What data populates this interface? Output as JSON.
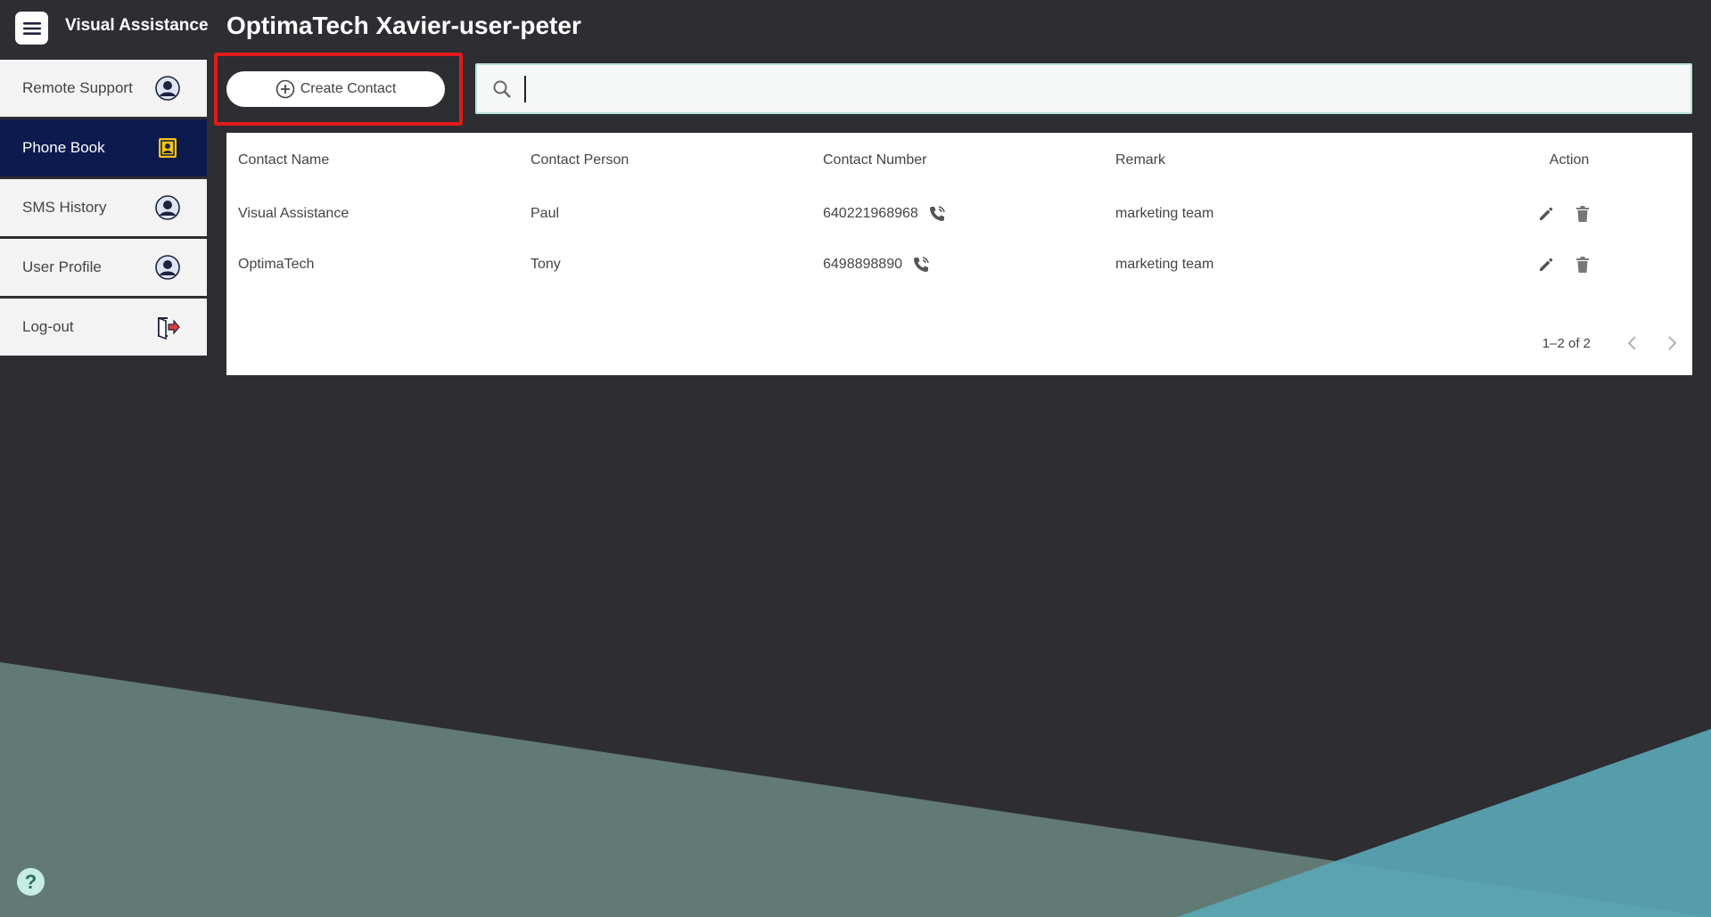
{
  "header": {
    "app_title": "Visual Assistance",
    "page_title": "OptimaTech Xavier-user-peter"
  },
  "sidebar": {
    "items": [
      {
        "label": "Remote Support",
        "icon": "user-avatar-icon",
        "active": false
      },
      {
        "label": "Phone Book",
        "icon": "contact-book-icon",
        "active": true
      },
      {
        "label": "SMS History",
        "icon": "user-avatar-icon",
        "active": false
      },
      {
        "label": "User Profile",
        "icon": "user-avatar-icon",
        "active": false
      },
      {
        "label": "Log-out",
        "icon": "logout-icon",
        "active": false
      }
    ]
  },
  "toolbar": {
    "create_label": "Create Contact",
    "search_value": "",
    "search_placeholder": ""
  },
  "table": {
    "columns": [
      "Contact Name",
      "Contact Person",
      "Contact Number",
      "Remark",
      "Action"
    ],
    "rows": [
      {
        "name": "Visual Assistance",
        "person": "Paul",
        "number": "640221968968",
        "remark": "marketing team"
      },
      {
        "name": "OptimaTech",
        "person": "Tony",
        "number": "6498898890",
        "remark": "marketing team"
      }
    ]
  },
  "pagination": {
    "range_text": "1–2 of 2"
  },
  "help": {
    "label": "?"
  },
  "colors": {
    "background": "#2e2d32",
    "sidebar_active": "#0d1a4d",
    "highlight": "#e01b1b",
    "search_border": "#b8e3dc",
    "accent_teal": "#5aa6b4",
    "contact_icon": "#f5c518",
    "logout_arrow": "#e23b3b"
  }
}
